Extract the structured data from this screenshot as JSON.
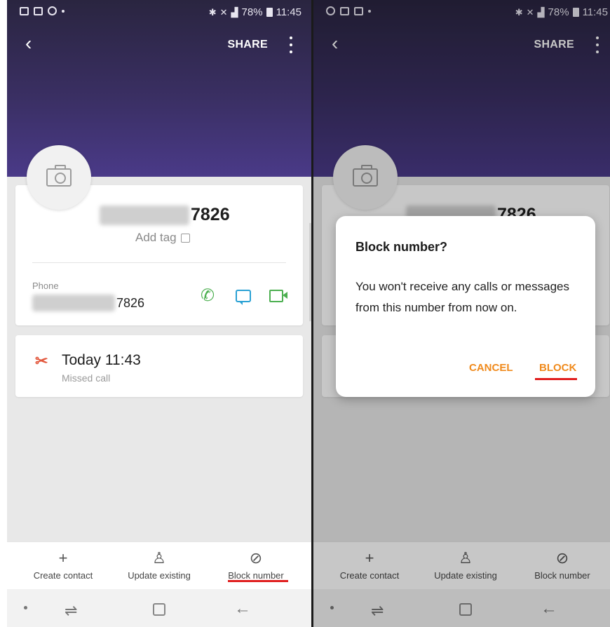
{
  "status_bar": {
    "battery": "78%",
    "time": "11:45"
  },
  "toolbar": {
    "back_glyph": "‹",
    "share_label": "SHARE"
  },
  "contact": {
    "number_suffix": "7826",
    "add_tag_label": "Add tag",
    "phone_label": "Phone",
    "phone_suffix": "7826"
  },
  "call_log": {
    "time": "Today 11:43",
    "type": "Missed call"
  },
  "bottom_actions": [
    {
      "label": "Create contact",
      "icon": "plus-icon"
    },
    {
      "label": "Update existing",
      "icon": "person-icon"
    },
    {
      "label": "Block number",
      "icon": "block-icon"
    }
  ],
  "dialog": {
    "title": "Block number?",
    "message": "You won't receive any calls or messages from this number from now on.",
    "cancel_label": "CANCEL",
    "block_label": "BLOCK"
  },
  "colors": {
    "accent_orange": "#f08a1c",
    "highlight_red": "#e01e1e",
    "call_green": "#4caf50",
    "message_blue": "#2aa1d4",
    "header_purple": "#3a2f63"
  }
}
